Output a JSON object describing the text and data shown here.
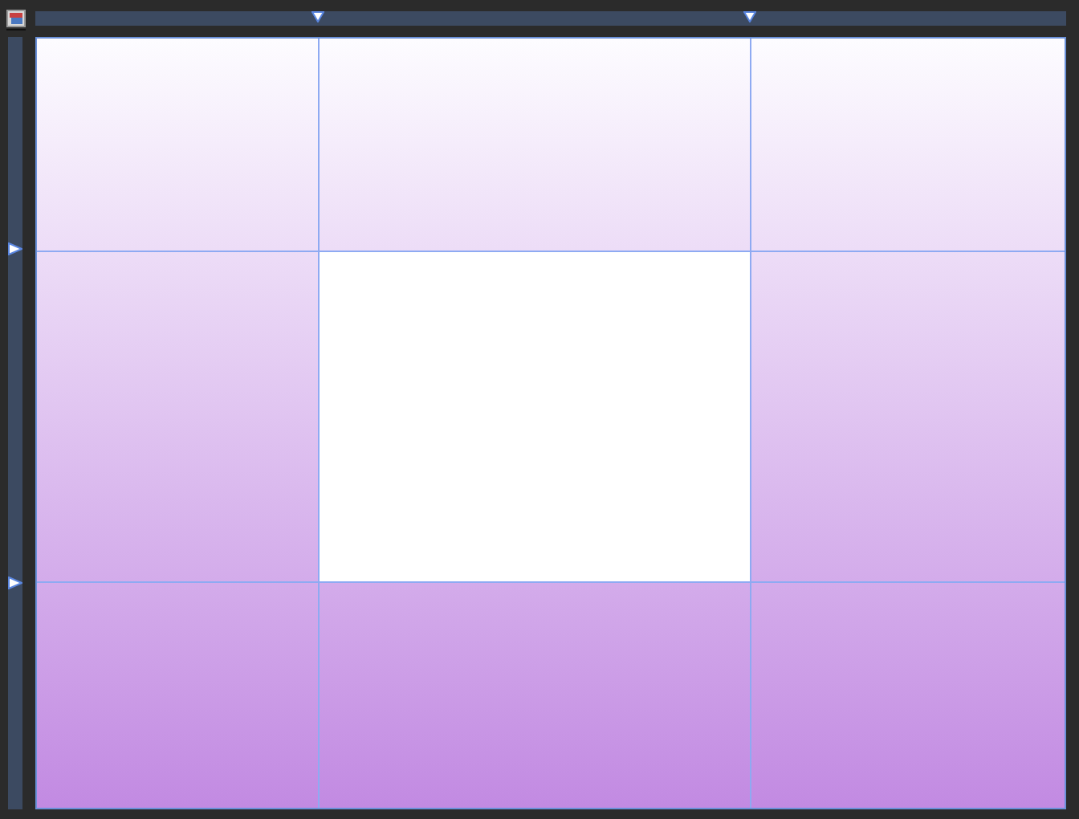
{
  "editor": {
    "guides": [
      {
        "kind": "vertical",
        "level": 0.274
      },
      {
        "kind": "vertical",
        "level": 0.693
      },
      {
        "kind": "horizontal"
      },
      {
        "kind": "horizontal"
      }
    ]
  }
}
